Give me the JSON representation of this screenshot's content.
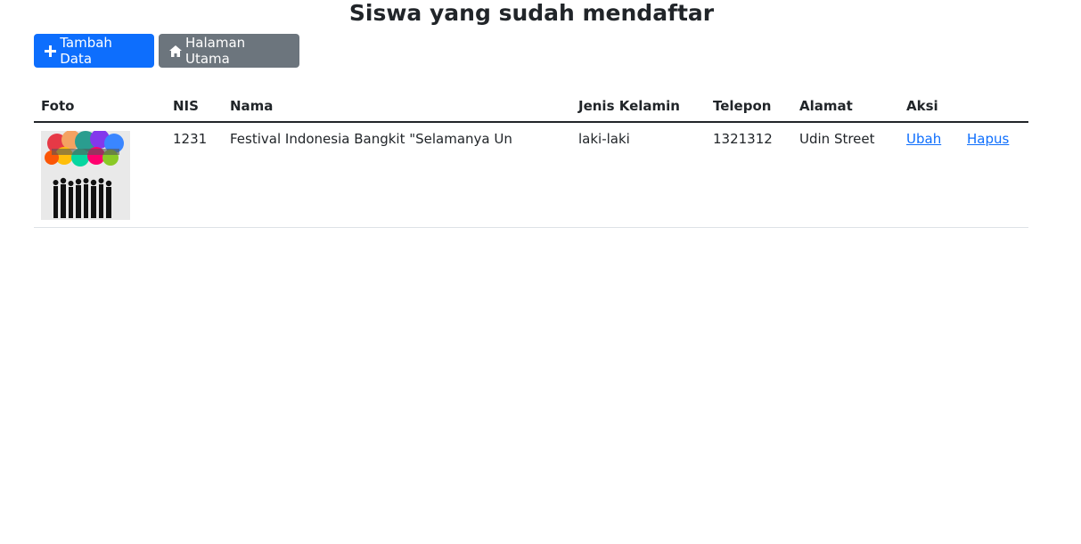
{
  "page": {
    "title": "Siswa yang sudah mendaftar"
  },
  "buttons": {
    "add_label": "Tambah Data",
    "home_label": "Halaman Utama"
  },
  "table": {
    "headers": [
      "Foto",
      "NIS",
      "Nama",
      "Jenis Kelamin",
      "Telepon",
      "Alamat",
      "Aksi"
    ],
    "rows": [
      {
        "nis": "1231",
        "nama": "Festival Indonesia Bangkit \"Selamanya Un",
        "jenis_kelamin": "laki-laki",
        "telepon": "1321312",
        "alamat": "Udin Street",
        "edit_label": "Ubah",
        "delete_label": "Hapus"
      }
    ]
  },
  "colors": {
    "primary": "#0d6efd",
    "secondary": "#6c757d",
    "text": "#212529"
  }
}
